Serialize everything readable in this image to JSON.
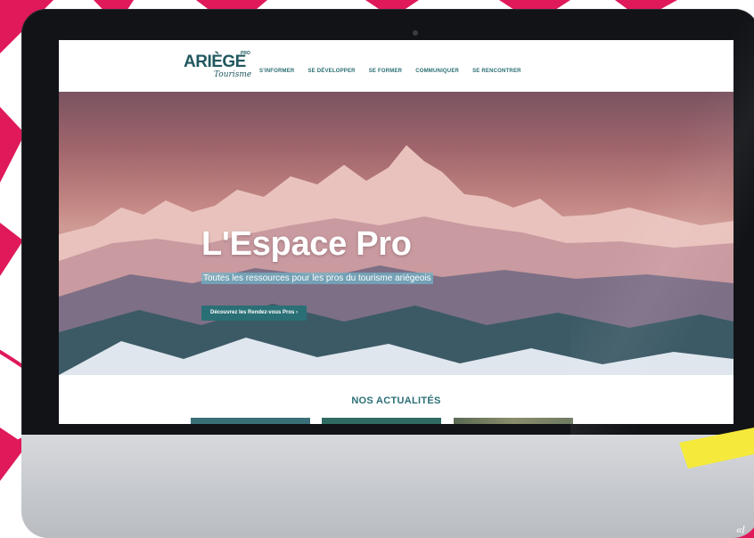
{
  "site": {
    "logo_text": "ARIÈGE",
    "logo_pro": "PRO",
    "logo_script": "Tourisme"
  },
  "nav": {
    "items": [
      {
        "label": "S'INFORMER"
      },
      {
        "label": "SE DÉVELOPPER"
      },
      {
        "label": "SE FORMER"
      },
      {
        "label": "COMMUNIQUER"
      },
      {
        "label": "SE RENCONTRER"
      }
    ]
  },
  "hero": {
    "title": "L'Espace Pro",
    "subtitle": "Toutes les ressources pour les pros du tourisme ariégeois",
    "cta_label": "Découvrez les Rendez-vous Pros ›"
  },
  "news": {
    "heading": "NOS ACTUALITÉS"
  },
  "page_fragment": "«l",
  "colors": {
    "brand_teal": "#2a6f76",
    "accent_pink": "#e0195a",
    "highlight_yellow": "#f5ea3b",
    "monitor_bezel": "#121316"
  }
}
